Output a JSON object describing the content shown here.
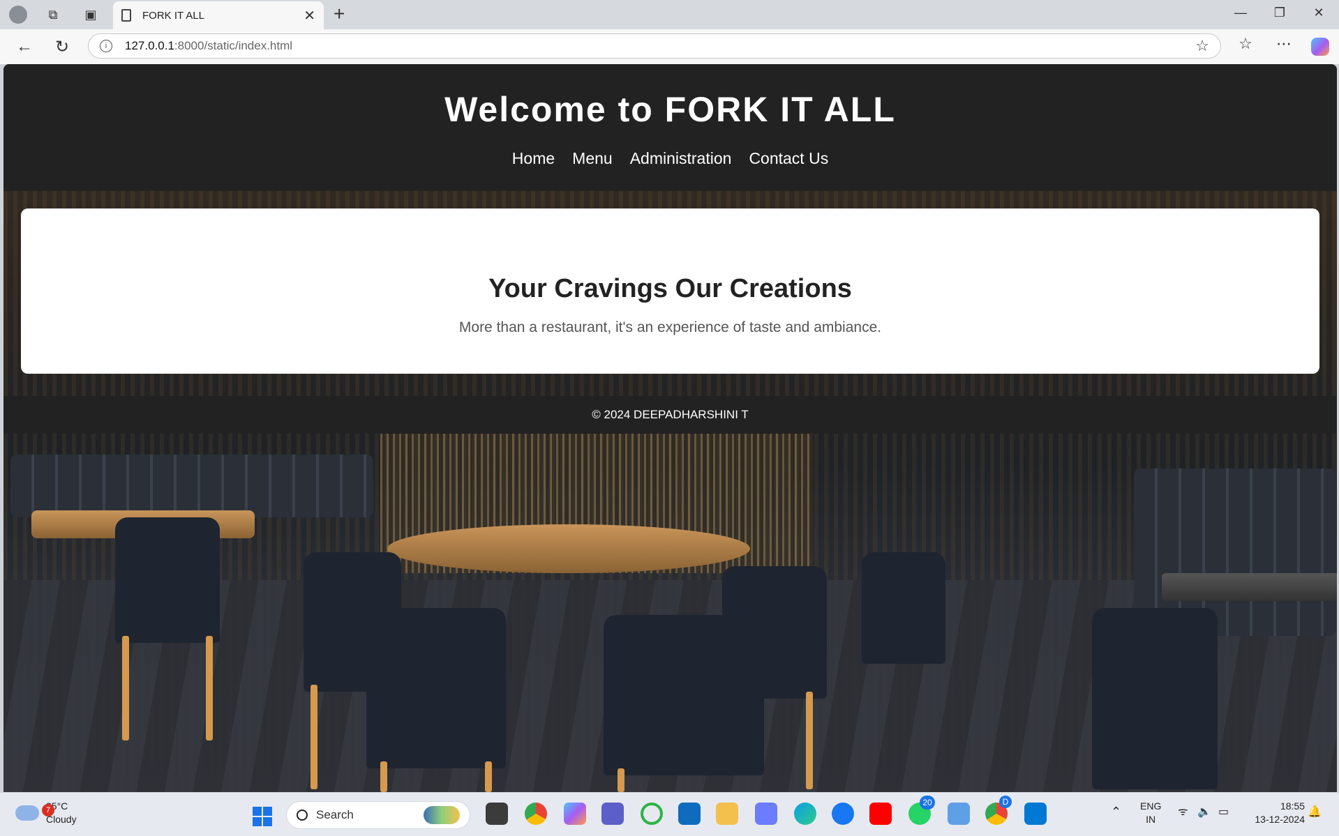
{
  "browser": {
    "tab_title": "FORK IT ALL",
    "url_host": "127.0.0.1",
    "url_path": ":8000/static/index.html"
  },
  "site": {
    "title": "Welcome to FORK IT ALL",
    "nav": [
      "Home",
      "Menu",
      "Administration",
      "Contact Us"
    ],
    "hero_title": "Your Cravings Our Creations",
    "hero_subtitle": "More than a restaurant, it's an experience of taste and ambiance.",
    "footer": "© 2024 DEEPADHARSHINI T",
    "colors": {
      "header_bg": "#222222",
      "card_bg": "#ffffff",
      "text": "#222222"
    }
  },
  "taskbar": {
    "weather_temp": "25°C",
    "weather_desc": "Cloudy",
    "weather_badge": "7",
    "search_label": "Search",
    "whatsapp_badge": "20",
    "chrome_badge": "D",
    "lang_top": "ENG",
    "lang_bottom": "IN",
    "time": "18:55",
    "date": "13-12-2024",
    "apps": [
      "file-explorer-icon",
      "chrome-icon",
      "copilot-icon",
      "teams-icon",
      "refresh-app-icon",
      "store-icon",
      "folder-icon",
      "arc-icon",
      "edge-icon",
      "facebook-icon",
      "youtube-icon",
      "whatsapp-icon",
      "notepad-icon",
      "chrome-profile-icon",
      "vscode-icon"
    ]
  }
}
